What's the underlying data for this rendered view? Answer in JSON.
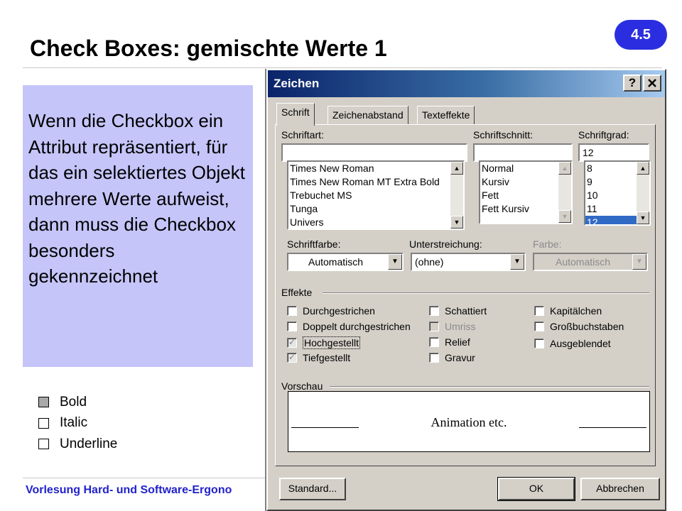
{
  "slide": {
    "title": "Check Boxes: gemischte Werte 1",
    "badge": "4.5",
    "info_text": "Wenn die Checkbox ein Attribut repräsentiert, für das ein selektiertes Objekt mehrere Werte aufweist, dann muss die Checkbox besonders gekennzeichnet",
    "demo_checkboxes": [
      {
        "label": "Bold",
        "state": "mixed"
      },
      {
        "label": "Italic",
        "state": "unchecked"
      },
      {
        "label": "Underline",
        "state": "unchecked"
      }
    ],
    "footer": "Vorlesung Hard- und Software-Ergono"
  },
  "dialog": {
    "title": "Zeichen",
    "help_button": "?",
    "close_button": "X",
    "tabs": [
      {
        "label": "Schrift",
        "active": true
      },
      {
        "label": "Zeichenabstand",
        "active": false
      },
      {
        "label": "Texteffekte",
        "active": false
      }
    ],
    "font": {
      "label": "Schriftart:",
      "value": "",
      "items": [
        "Times New Roman",
        "Times New Roman MT Extra Bold",
        "Trebuchet MS",
        "Tunga",
        "Univers"
      ]
    },
    "style": {
      "label": "Schriftschnitt:",
      "value": "",
      "items": [
        "Normal",
        "Kursiv",
        "Fett",
        "Fett Kursiv"
      ]
    },
    "size": {
      "label": "Schriftgrad:",
      "value": "12",
      "items": [
        "8",
        "9",
        "10",
        "11",
        "12"
      ],
      "selected": "12"
    },
    "color": {
      "label": "Schriftfarbe:",
      "value": "Automatisch"
    },
    "underline": {
      "label": "Unterstreichung:",
      "value": "(ohne)"
    },
    "underline_color": {
      "label": "Farbe:",
      "value": "Automatisch",
      "disabled": true
    },
    "effects": {
      "label": "Effekte",
      "items": [
        {
          "label": "Durchgestrichen",
          "state": "unchecked",
          "disabled": false
        },
        {
          "label": "Doppelt durchgestrichen",
          "state": "unchecked",
          "disabled": false
        },
        {
          "label": "Hochgestellt",
          "state": "mixed",
          "disabled": false,
          "focused": true
        },
        {
          "label": "Tiefgestellt",
          "state": "mixed",
          "disabled": false
        },
        {
          "label": "Schattiert",
          "state": "unchecked",
          "disabled": false
        },
        {
          "label": "Umriss",
          "state": "unchecked",
          "disabled": true
        },
        {
          "label": "Relief",
          "state": "unchecked",
          "disabled": false
        },
        {
          "label": "Gravur",
          "state": "unchecked",
          "disabled": false
        },
        {
          "label": "Kapitälchen",
          "state": "unchecked",
          "disabled": false
        },
        {
          "label": "Großbuchstaben",
          "state": "unchecked",
          "disabled": false
        },
        {
          "label": "Ausgeblendet",
          "state": "unchecked",
          "disabled": false
        }
      ]
    },
    "preview": {
      "label": "Vorschau",
      "text": "Animation etc."
    },
    "buttons": {
      "standard": "Standard...",
      "ok": "OK",
      "cancel": "Abbrechen"
    }
  }
}
